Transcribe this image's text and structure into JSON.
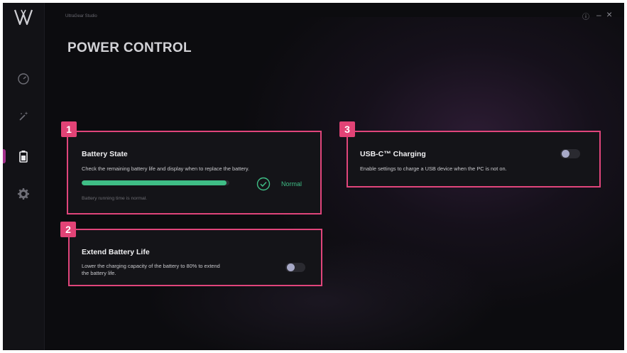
{
  "app": {
    "title": "UltraGear Studio",
    "page_title": "POWER CONTROL"
  },
  "window_controls": {
    "info": "ⓘ",
    "minimize": "–",
    "close": "×"
  },
  "sidebar": {
    "items": [
      {
        "name": "performance",
        "icon": "speedometer-icon"
      },
      {
        "name": "effects",
        "icon": "magic-wand-icon"
      },
      {
        "name": "power",
        "icon": "battery-icon",
        "active": true
      },
      {
        "name": "settings",
        "icon": "gear-icon"
      }
    ]
  },
  "cards": {
    "battery_state": {
      "badge": "1",
      "title": "Battery State",
      "description": "Check the remaining battery life and display when to replace the battery.",
      "progress": 0.98,
      "status": "Normal",
      "note": "Battery running time is normal."
    },
    "extend_battery": {
      "badge": "2",
      "title": "Extend Battery Life",
      "description_line1": "Lower the charging capacity of the battery to 80% to extend",
      "description_line2": "the battery life.",
      "toggle_on": false
    },
    "usb_c": {
      "badge": "3",
      "title": "USB-C™ Charging",
      "description": "Enable settings to charge a USB device when the PC is not on.",
      "toggle_on": false
    }
  },
  "colors": {
    "accent": "#e24376",
    "status_green": "#3fbe86",
    "sidebar_active": "#a4308c"
  }
}
